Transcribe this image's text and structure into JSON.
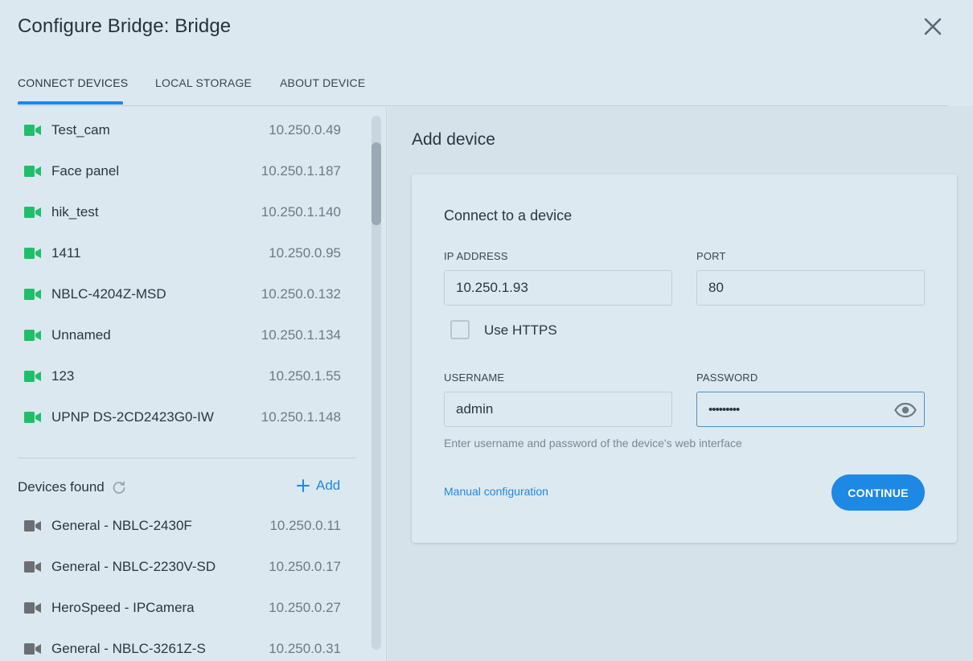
{
  "dialog": {
    "title": "Configure Bridge: Bridge"
  },
  "tabs": [
    {
      "label": "CONNECT DEVICES",
      "active": true
    },
    {
      "label": "LOCAL STORAGE",
      "active": false
    },
    {
      "label": "ABOUT DEVICE",
      "active": false
    }
  ],
  "connected_devices": [
    {
      "name": "Test_cam",
      "ip": "10.250.0.49"
    },
    {
      "name": "Face panel",
      "ip": "10.250.1.187"
    },
    {
      "name": "hik_test",
      "ip": "10.250.1.140"
    },
    {
      "name": "1411",
      "ip": "10.250.0.95"
    },
    {
      "name": "NBLC-4204Z-MSD",
      "ip": "10.250.0.132"
    },
    {
      "name": "Unnamed",
      "ip": "10.250.1.134"
    },
    {
      "name": "123",
      "ip": "10.250.1.55"
    },
    {
      "name": "UPNP DS-2CD2423G0-IW",
      "ip": "10.250.1.148"
    }
  ],
  "devices_found": {
    "label": "Devices found",
    "add_label": "Add",
    "items": [
      {
        "name": "General - NBLC-2430F",
        "ip": "10.250.0.11"
      },
      {
        "name": "General - NBLC-2230V-SD",
        "ip": "10.250.0.17"
      },
      {
        "name": "HeroSpeed - IPCamera",
        "ip": "10.250.0.27"
      },
      {
        "name": "General - NBLC-3261Z-S",
        "ip": "10.250.0.31"
      }
    ]
  },
  "add_device": {
    "title": "Add device",
    "card_title": "Connect to a device",
    "ip_label": "IP ADDRESS",
    "ip_value": "10.250.1.93",
    "port_label": "PORT",
    "port_value": "80",
    "https_label": "Use HTTPS",
    "https_checked": false,
    "username_label": "USERNAME",
    "username_value": "admin",
    "password_label": "PASSWORD",
    "password_value": "•••••••••",
    "hint": "Enter username and password of the device's web interface",
    "manual_link": "Manual configuration",
    "continue_label": "CONTINUE"
  },
  "colors": {
    "accent": "#1e88e5",
    "online_camera": "#1fbf6a",
    "found_camera": "#6b6f73",
    "background": "#dbe8f0"
  },
  "icons": {
    "close": "close-icon",
    "camera": "video-camera-icon",
    "refresh": "refresh-icon",
    "add": "plus-icon",
    "show_password": "eye-icon"
  }
}
